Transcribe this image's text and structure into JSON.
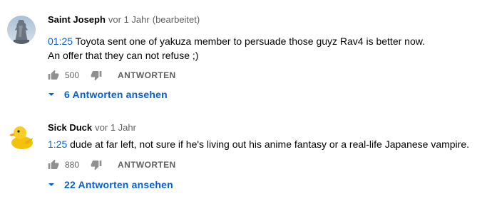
{
  "comments": [
    {
      "author": "Saint Joseph",
      "time": "vor 1 Jahr",
      "edited": "(bearbeitet)",
      "avatar_icon": "statue-avatar-icon",
      "timestamp": "01:25",
      "text_line1": " Toyota sent one of yakuza member to persuade those guyz Rav4 is better now.",
      "text_line2": "An offer that they can not refuse ;)",
      "likes": "500",
      "reply_label": "ANTWORTEN",
      "replies_label": "6 Antworten ansehen"
    },
    {
      "author": "Sick Duck",
      "time": "vor 1 Jahr",
      "avatar_icon": "rubber-duck-avatar-icon",
      "timestamp": "1:25",
      "text_line1": " dude at far left, not sure if he's living out his anime fantasy or a real-life Japanese vampire.",
      "likes": "880",
      "reply_label": "ANTWORTEN",
      "replies_label": "22 Antworten ansehen"
    }
  ],
  "colors": {
    "link": "#065fd4",
    "secondary_text": "#606060",
    "primary_text": "#030303"
  }
}
